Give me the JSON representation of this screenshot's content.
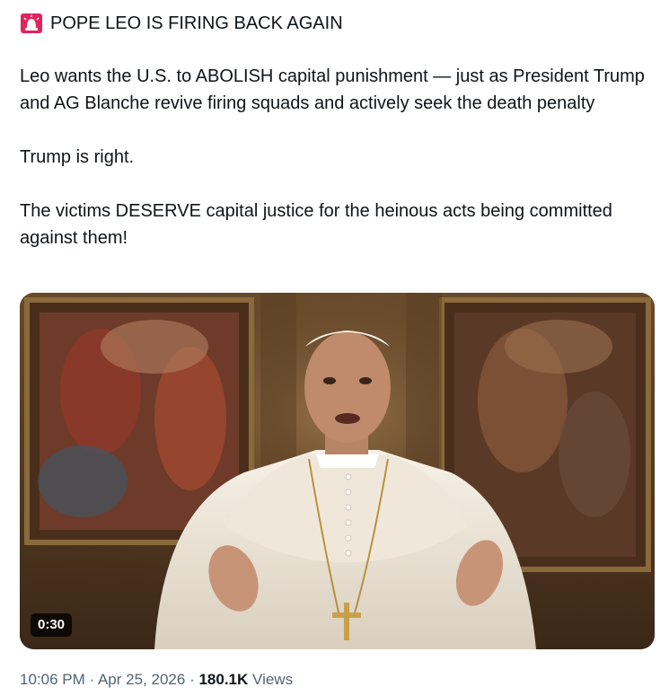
{
  "post": {
    "headline": "POPE LEO IS FIRING BACK AGAIN",
    "headline_icon": "rotating-light-icon",
    "paragraph1": "Leo wants the U.S. to ABOLISH capital punishment — just as President Trump and AG Blanche revive firing squads and actively seek the death penalty",
    "paragraph2": "Trump is right.",
    "paragraph3": "The victims DESERVE capital justice for the heinous acts being committed against them!"
  },
  "media": {
    "duration": "0:30"
  },
  "meta": {
    "time": "10:06 PM",
    "separator": "·",
    "date": "Apr 25, 2026",
    "views_count": "180.1K",
    "views_label": "Views"
  },
  "colors": {
    "text": "#0f1419",
    "muted": "#536471",
    "siren": "#e0245e"
  }
}
